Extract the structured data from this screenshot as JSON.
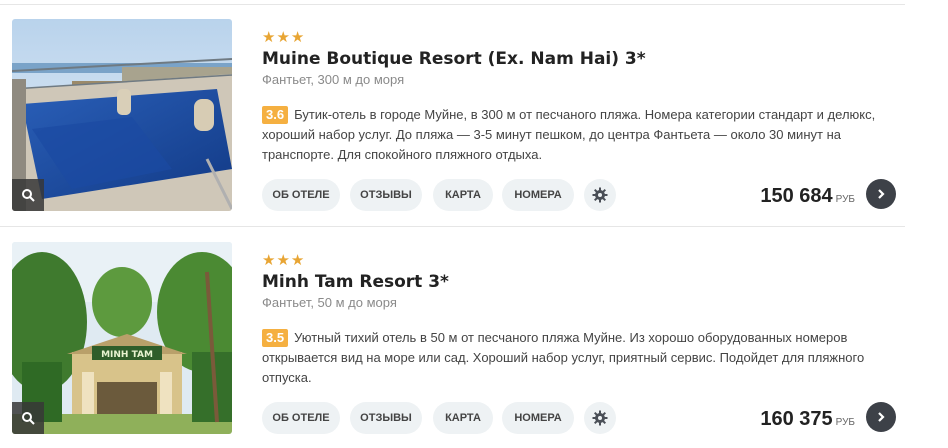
{
  "hotels": [
    {
      "stars": "★★★",
      "name": "Muine Boutique Resort (Ex. Nam Hai) 3*",
      "location": "Фантьет, 300 м до моря",
      "rating": "3.6",
      "description": "Бутик-отель в городе Муйне, в 300 м от песчаного пляжа. Номера категории стандарт и делюкс, хороший набор услуг. До пляжа — 3-5 минут пешком, до центра Фантьета — около 30 минут на транспорте. Для спокойного пляжного отдыха.",
      "price": "150 684",
      "currency": "РУБ",
      "buttons": {
        "about": "ОБ ОТЕЛЕ",
        "reviews": "ОТЗЫВЫ",
        "map": "КАРТА",
        "rooms": "НОМЕРА"
      },
      "icons": {
        "zoom": "search-icon",
        "settings": "gear-icon",
        "go": "chevron-right-icon"
      }
    },
    {
      "stars": "★★★",
      "name": "Minh Tam Resort 3*",
      "location": "Фантьет, 50 м до моря",
      "rating": "3.5",
      "description": "Уютный тихий отель в 50 м от песчаного пляжа Муйне. Из хорошо оборудованных номеров открывается вид на море или сад. Хороший набор услуг, приятный сервис. Подойдет для пляжного отпуска.",
      "price": "160 375",
      "currency": "РУБ",
      "sign_text": "MINH TAM",
      "buttons": {
        "about": "ОБ ОТЕЛЕ",
        "reviews": "ОТЗЫВЫ",
        "map": "КАРТА",
        "rooms": "НОМЕРА"
      },
      "icons": {
        "zoom": "search-icon",
        "settings": "gear-icon",
        "go": "chevron-right-icon"
      }
    }
  ],
  "colors": {
    "star": "#e8a534",
    "rating_badge": "#f5b041",
    "button_bg": "#eef2f4",
    "go_button": "#3d4148"
  }
}
